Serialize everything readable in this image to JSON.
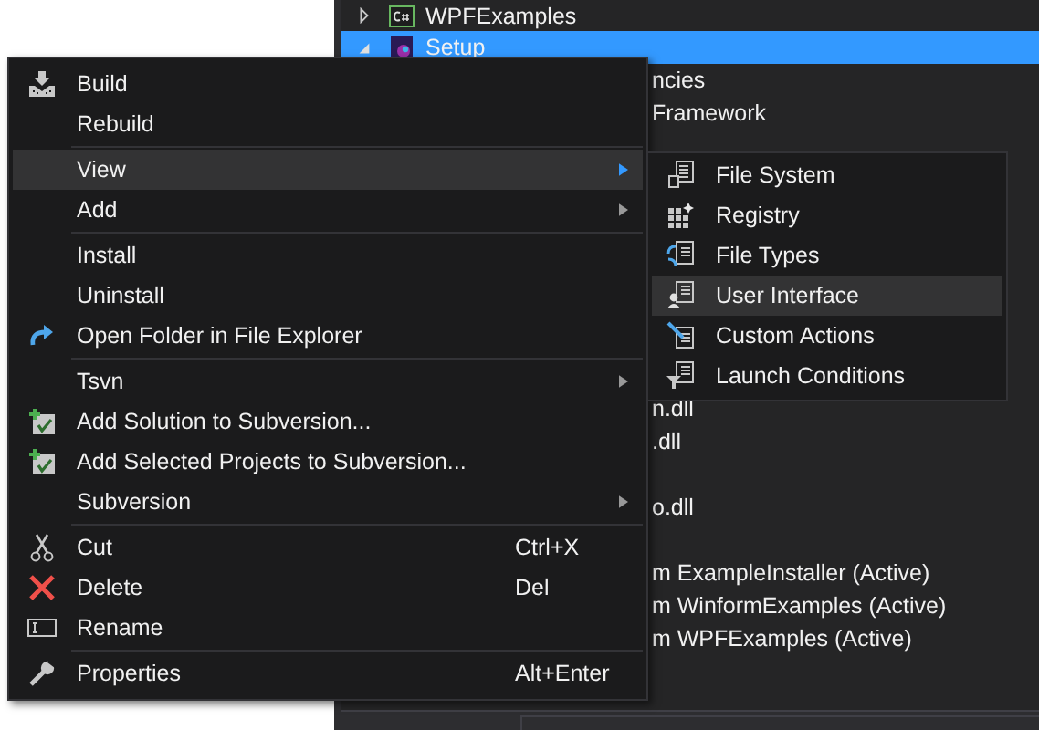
{
  "tree": [
    {
      "label": "WPFExamples",
      "kind": "csharp",
      "expanded": false,
      "selected": false
    },
    {
      "label": "Setup",
      "kind": "setup",
      "expanded": true,
      "selected": true,
      "children": [
        {
          "label": "ncies"
        },
        {
          "label": "Framework"
        },
        {
          "label": "n.dll"
        },
        {
          "label": ".dll"
        },
        {
          "label": "o.dll"
        },
        {
          "label": "m ExampleInstaller (Active)"
        },
        {
          "label": "m WinformExamples (Active)"
        },
        {
          "label": "m WPFExamples (Active)"
        }
      ]
    }
  ],
  "context_menu": [
    {
      "kind": "item",
      "label": "Build",
      "submenu": false,
      "selected": false
    },
    {
      "kind": "item",
      "label": "Rebuild",
      "submenu": false,
      "selected": false
    },
    {
      "kind": "separator"
    },
    {
      "kind": "item",
      "label": "View",
      "submenu": true,
      "selected": true
    },
    {
      "kind": "item",
      "label": "Add",
      "submenu": true,
      "selected": false
    },
    {
      "kind": "separator"
    },
    {
      "kind": "item",
      "label": "Install",
      "submenu": false,
      "selected": false
    },
    {
      "kind": "item",
      "label": "Uninstall",
      "submenu": false,
      "selected": false
    },
    {
      "kind": "item",
      "label": "Open Folder in File Explorer",
      "submenu": false,
      "selected": false
    },
    {
      "kind": "separator"
    },
    {
      "kind": "item",
      "label": "Tsvn",
      "submenu": true,
      "selected": false
    },
    {
      "kind": "item",
      "label": "Add Solution to Subversion...",
      "submenu": false,
      "selected": false
    },
    {
      "kind": "item",
      "label": "Add Selected Projects to Subversion...",
      "submenu": false,
      "selected": false
    },
    {
      "kind": "item",
      "label": "Subversion",
      "submenu": true,
      "selected": false
    },
    {
      "kind": "separator"
    },
    {
      "kind": "item",
      "label": "Cut",
      "shortcut": "Ctrl+X",
      "submenu": false,
      "selected": false
    },
    {
      "kind": "item",
      "label": "Delete",
      "shortcut": "Del",
      "submenu": false,
      "selected": false
    },
    {
      "kind": "item",
      "label": "Rename",
      "submenu": false,
      "selected": false
    },
    {
      "kind": "separator"
    },
    {
      "kind": "item",
      "label": "Properties",
      "shortcut": "Alt+Enter",
      "submenu": false,
      "selected": false
    }
  ],
  "view_submenu": [
    {
      "label": "File System",
      "selected": false
    },
    {
      "label": "Registry",
      "selected": false
    },
    {
      "label": "File Types",
      "selected": false
    },
    {
      "label": "User Interface",
      "selected": true
    },
    {
      "label": "Custom Actions",
      "selected": false
    },
    {
      "label": "Launch Conditions",
      "selected": false
    }
  ]
}
